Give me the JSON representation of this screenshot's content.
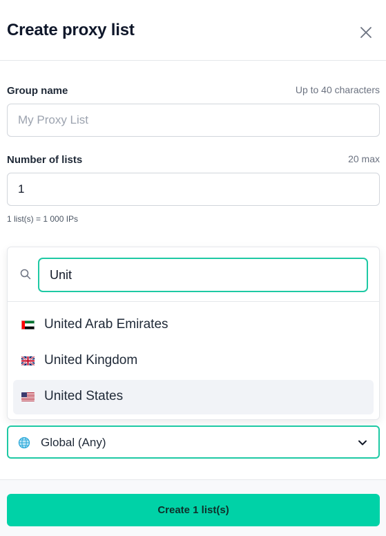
{
  "modal": {
    "title": "Create proxy list",
    "close_icon": "close-icon"
  },
  "group_name": {
    "label": "Group name",
    "hint": "Up to 40 characters",
    "value": "",
    "placeholder": "My Proxy List"
  },
  "number_of_lists": {
    "label": "Number of lists",
    "hint": "20 max",
    "value": "1",
    "note": "1 list(s) = 1 000 IPs"
  },
  "country_dropdown": {
    "search_icon": "search-icon",
    "search_value": "Unit",
    "options": [
      {
        "label": "United Arab Emirates",
        "flag_icon": "uae-flag-icon",
        "selected": false
      },
      {
        "label": "United Kingdom",
        "flag_icon": "uk-flag-icon",
        "selected": false
      },
      {
        "label": "United States",
        "flag_icon": "us-flag-icon",
        "selected": true
      }
    ]
  },
  "location_select": {
    "icon": "globe-icon",
    "value": "Global (Any)",
    "chevron_icon": "chevron-down-icon"
  },
  "footer": {
    "create_button": "Create 1 list(s)"
  },
  "colors": {
    "accent": "#00d2a7",
    "focus_border": "#1ec9a4",
    "selected_option_bg": "#f1f3f7"
  }
}
